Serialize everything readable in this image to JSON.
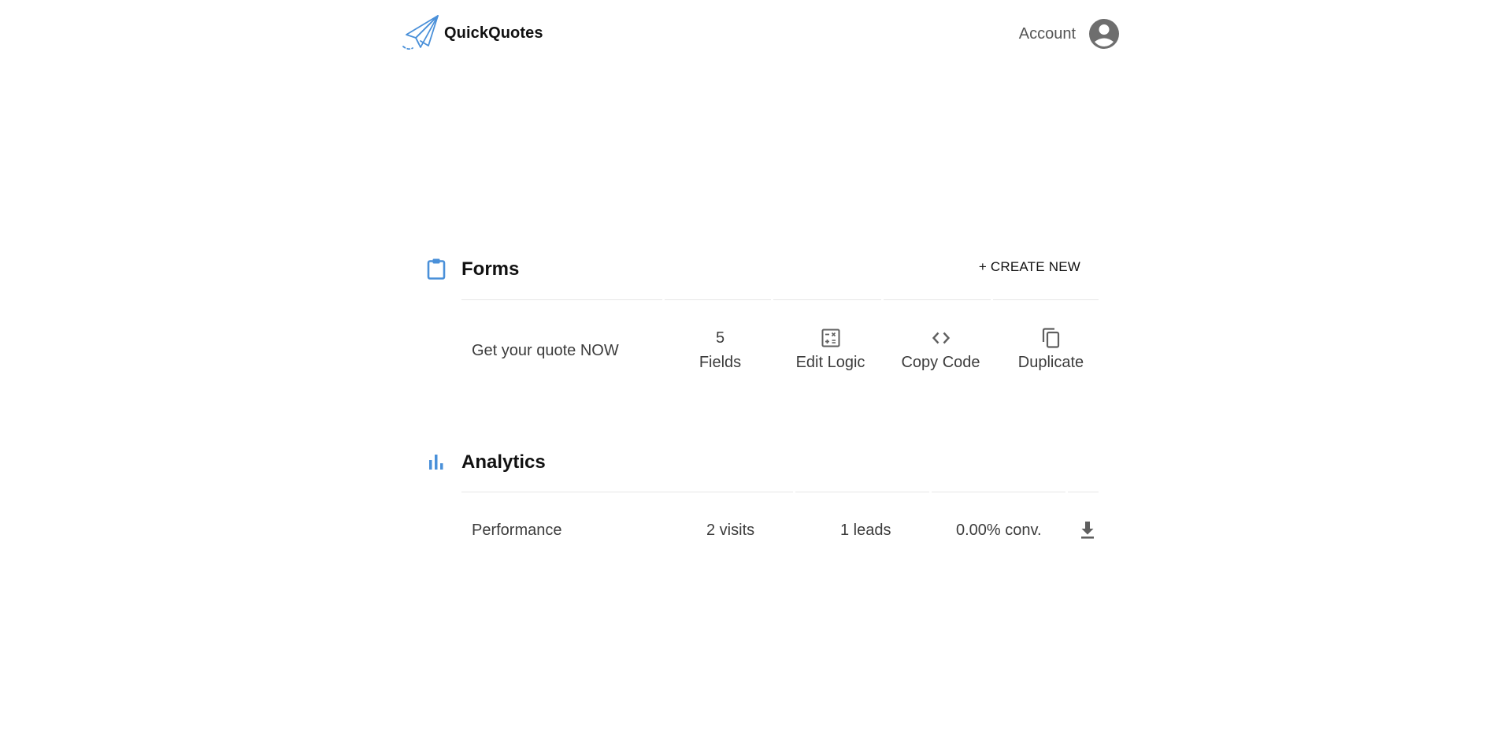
{
  "header": {
    "brand_name": "QuickQuotes",
    "account_label": "Account",
    "icons": {
      "logo": "paper-plane-icon",
      "account": "account-circle-icon"
    }
  },
  "forms": {
    "title": "Forms",
    "create_label": "+ CREATE NEW",
    "icon": "clipboard-icon",
    "items": [
      {
        "name": "Get your quote NOW",
        "fields_count": "5",
        "fields_label": "Fields",
        "edit_logic_label": "Edit Logic",
        "copy_code_label": "Copy Code",
        "duplicate_label": "Duplicate"
      }
    ]
  },
  "analytics": {
    "title": "Analytics",
    "icon": "bar-chart-icon",
    "rows": [
      {
        "label": "Performance",
        "visits": "2 visits",
        "leads": "1 leads",
        "conversion": "0.00% conv."
      }
    ]
  },
  "colors": {
    "accent": "#4a90d9",
    "icon_gray": "#5f5f5f",
    "text": "#3c3c3c",
    "divider": "#e6e6e6"
  }
}
